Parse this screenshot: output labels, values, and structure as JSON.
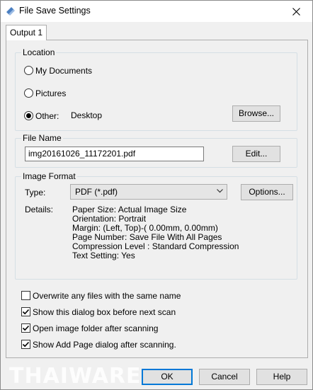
{
  "window": {
    "title": "File Save Settings",
    "close_glyph": "✕"
  },
  "tabs": [
    {
      "label": "Output 1"
    }
  ],
  "location": {
    "label": "Location",
    "options": [
      {
        "label": "My Documents",
        "checked": false
      },
      {
        "label": "Pictures",
        "checked": false
      },
      {
        "label": "Other:",
        "checked": true
      }
    ],
    "other_value": "Desktop",
    "browse_label": "Browse..."
  },
  "file_name": {
    "label": "File Name",
    "value": "img20161026_11172201.pdf",
    "edit_label": "Edit..."
  },
  "image_format": {
    "label": "Image Format",
    "type_label": "Type:",
    "type_value": "PDF (*.pdf)",
    "options_label": "Options...",
    "details_label": "Details:",
    "details_lines": [
      "Paper Size: Actual Image Size",
      "Orientation: Portrait",
      "Margin: (Left, Top)-( 0.00mm, 0.00mm)",
      "Page Number: Save File With All Pages",
      "Compression Level : Standard Compression",
      "Text Setting: Yes"
    ]
  },
  "checkboxes": [
    {
      "label": "Overwrite any files with the same name",
      "checked": false
    },
    {
      "label": "Show this dialog box before next scan",
      "checked": true
    },
    {
      "label": "Open image folder after scanning",
      "checked": true
    },
    {
      "label": "Show Add Page dialog after scanning.",
      "checked": true
    }
  ],
  "footer": {
    "ok_label": "OK",
    "cancel_label": "Cancel",
    "help_label": "Help"
  },
  "watermark": "THAIWARE",
  "colors": {
    "accent": "#0078d7",
    "face": "#f0f0f0",
    "button": "#e1e1e1"
  }
}
